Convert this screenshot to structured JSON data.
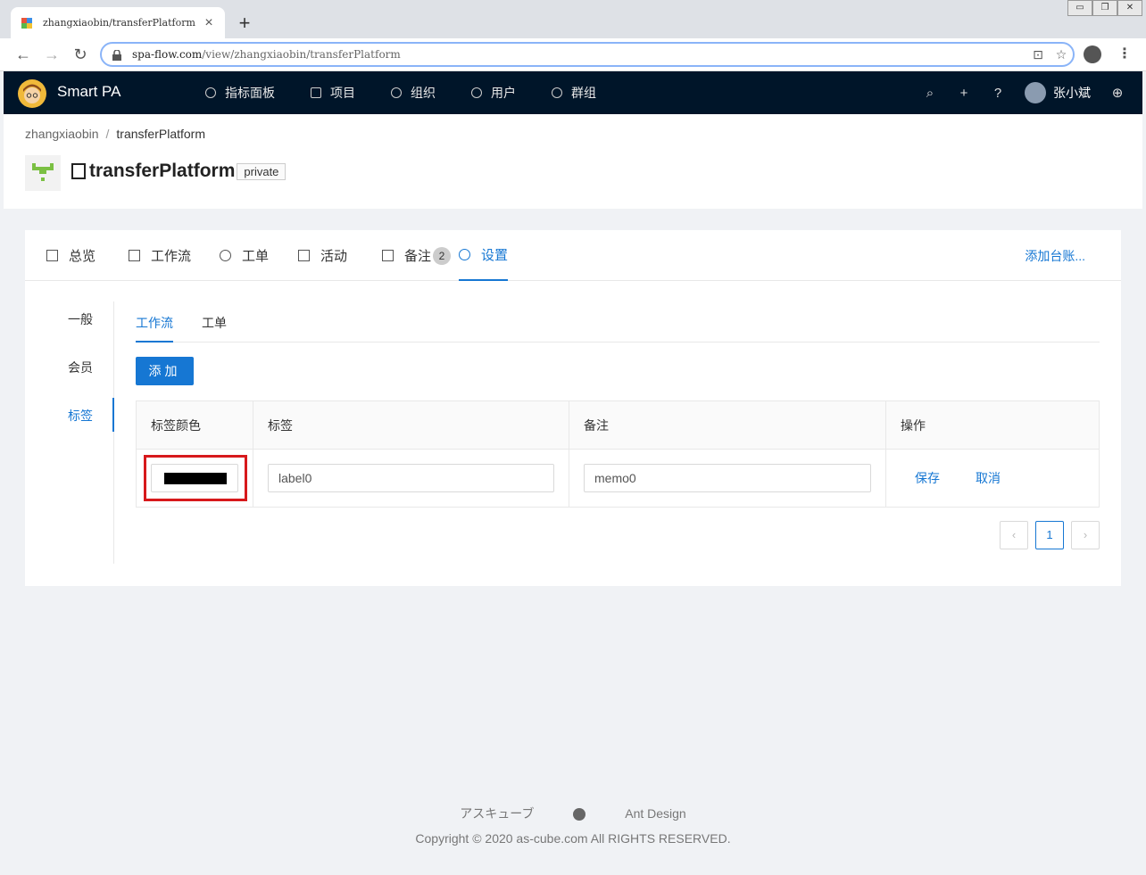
{
  "browser": {
    "tab_title": "zhangxiaobin/transferPlatform",
    "tab_close": "×",
    "new_tab": "+",
    "url_host": "spa-flow.com",
    "url_path": "/view/zhangxiaobin/transferPlatform",
    "window_controls": [
      "▭",
      "❐",
      "✕"
    ]
  },
  "header": {
    "app_name": "Smart PA",
    "nav": [
      {
        "label": "指标面板",
        "icon": "dashboard-icon"
      },
      {
        "label": "项目",
        "icon": "project-icon"
      },
      {
        "label": "组织",
        "icon": "team-icon"
      },
      {
        "label": "用户",
        "icon": "user-icon"
      },
      {
        "label": "群组",
        "icon": "group-icon"
      }
    ],
    "user_name": "张小斌"
  },
  "project": {
    "breadcrumb": [
      "zhangxiaobin",
      "transferPlatform"
    ],
    "name": "transferPlatform",
    "visibility": "private"
  },
  "tabs": [
    {
      "label": "总览",
      "icon": "bar-chart-icon"
    },
    {
      "label": "工作流",
      "icon": "workflow-icon"
    },
    {
      "label": "工单",
      "icon": "ticket-icon"
    },
    {
      "label": "活动",
      "icon": "activity-icon"
    },
    {
      "label": "备注",
      "icon": "note-icon",
      "badge": "2"
    },
    {
      "label": "设置",
      "icon": "gear-icon",
      "active": true
    }
  ],
  "add_ledger": "添加台账...",
  "side_menu": [
    "一般",
    "会员",
    "标签"
  ],
  "sub_tabs": [
    "工作流",
    "工单"
  ],
  "add_button": "添加",
  "table": {
    "columns": [
      "标签颜色",
      "标签",
      "备注",
      "操作"
    ],
    "row": {
      "color": "#000000",
      "label": "label0",
      "memo": "memo0",
      "save": "保存",
      "cancel": "取消"
    }
  },
  "pagination": {
    "prev": "‹",
    "page": "1",
    "next": "›"
  },
  "footer": {
    "links": [
      "アスキューブ",
      "Ant Design"
    ],
    "copyright": "Copyright © 2020 as-cube.com All RIGHTS RESERVED."
  },
  "colors": {
    "accent": "#1677d3",
    "header_bg": "#001529",
    "highlight": "#d7191c"
  }
}
